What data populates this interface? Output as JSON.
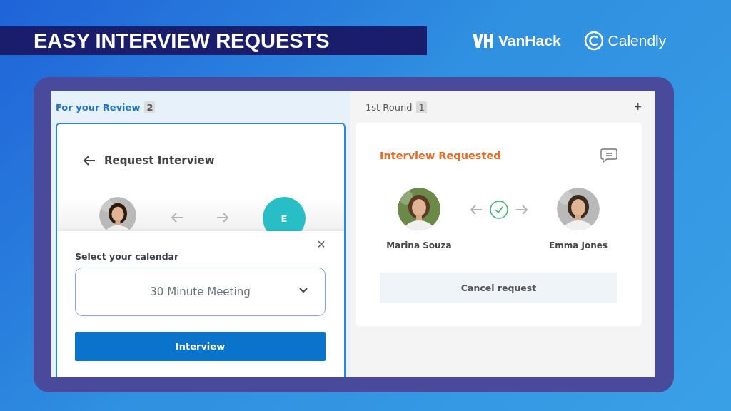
{
  "banner": {
    "title": "EASY INTERVIEW REQUESTS"
  },
  "logos": [
    {
      "kind": "vanhack",
      "name": "VanHack"
    },
    {
      "kind": "calendly",
      "name": "Calendly"
    }
  ],
  "columns": [
    {
      "title": "For your Review",
      "count": "2",
      "selected": true
    },
    {
      "title": "1st Round",
      "count": "1",
      "selected": false
    }
  ],
  "add_button": "+",
  "request_card": {
    "title": "Request Interview",
    "candidate_initial": "E",
    "sheet": {
      "label": "Select your calendar",
      "close": "×",
      "select_value": "30 Minute Meeting",
      "submit": "Interview"
    }
  },
  "status_card": {
    "status": "Interview Requested",
    "people": [
      "Marina Souza",
      "Emma Jones"
    ],
    "cancel": "Cancel request"
  }
}
